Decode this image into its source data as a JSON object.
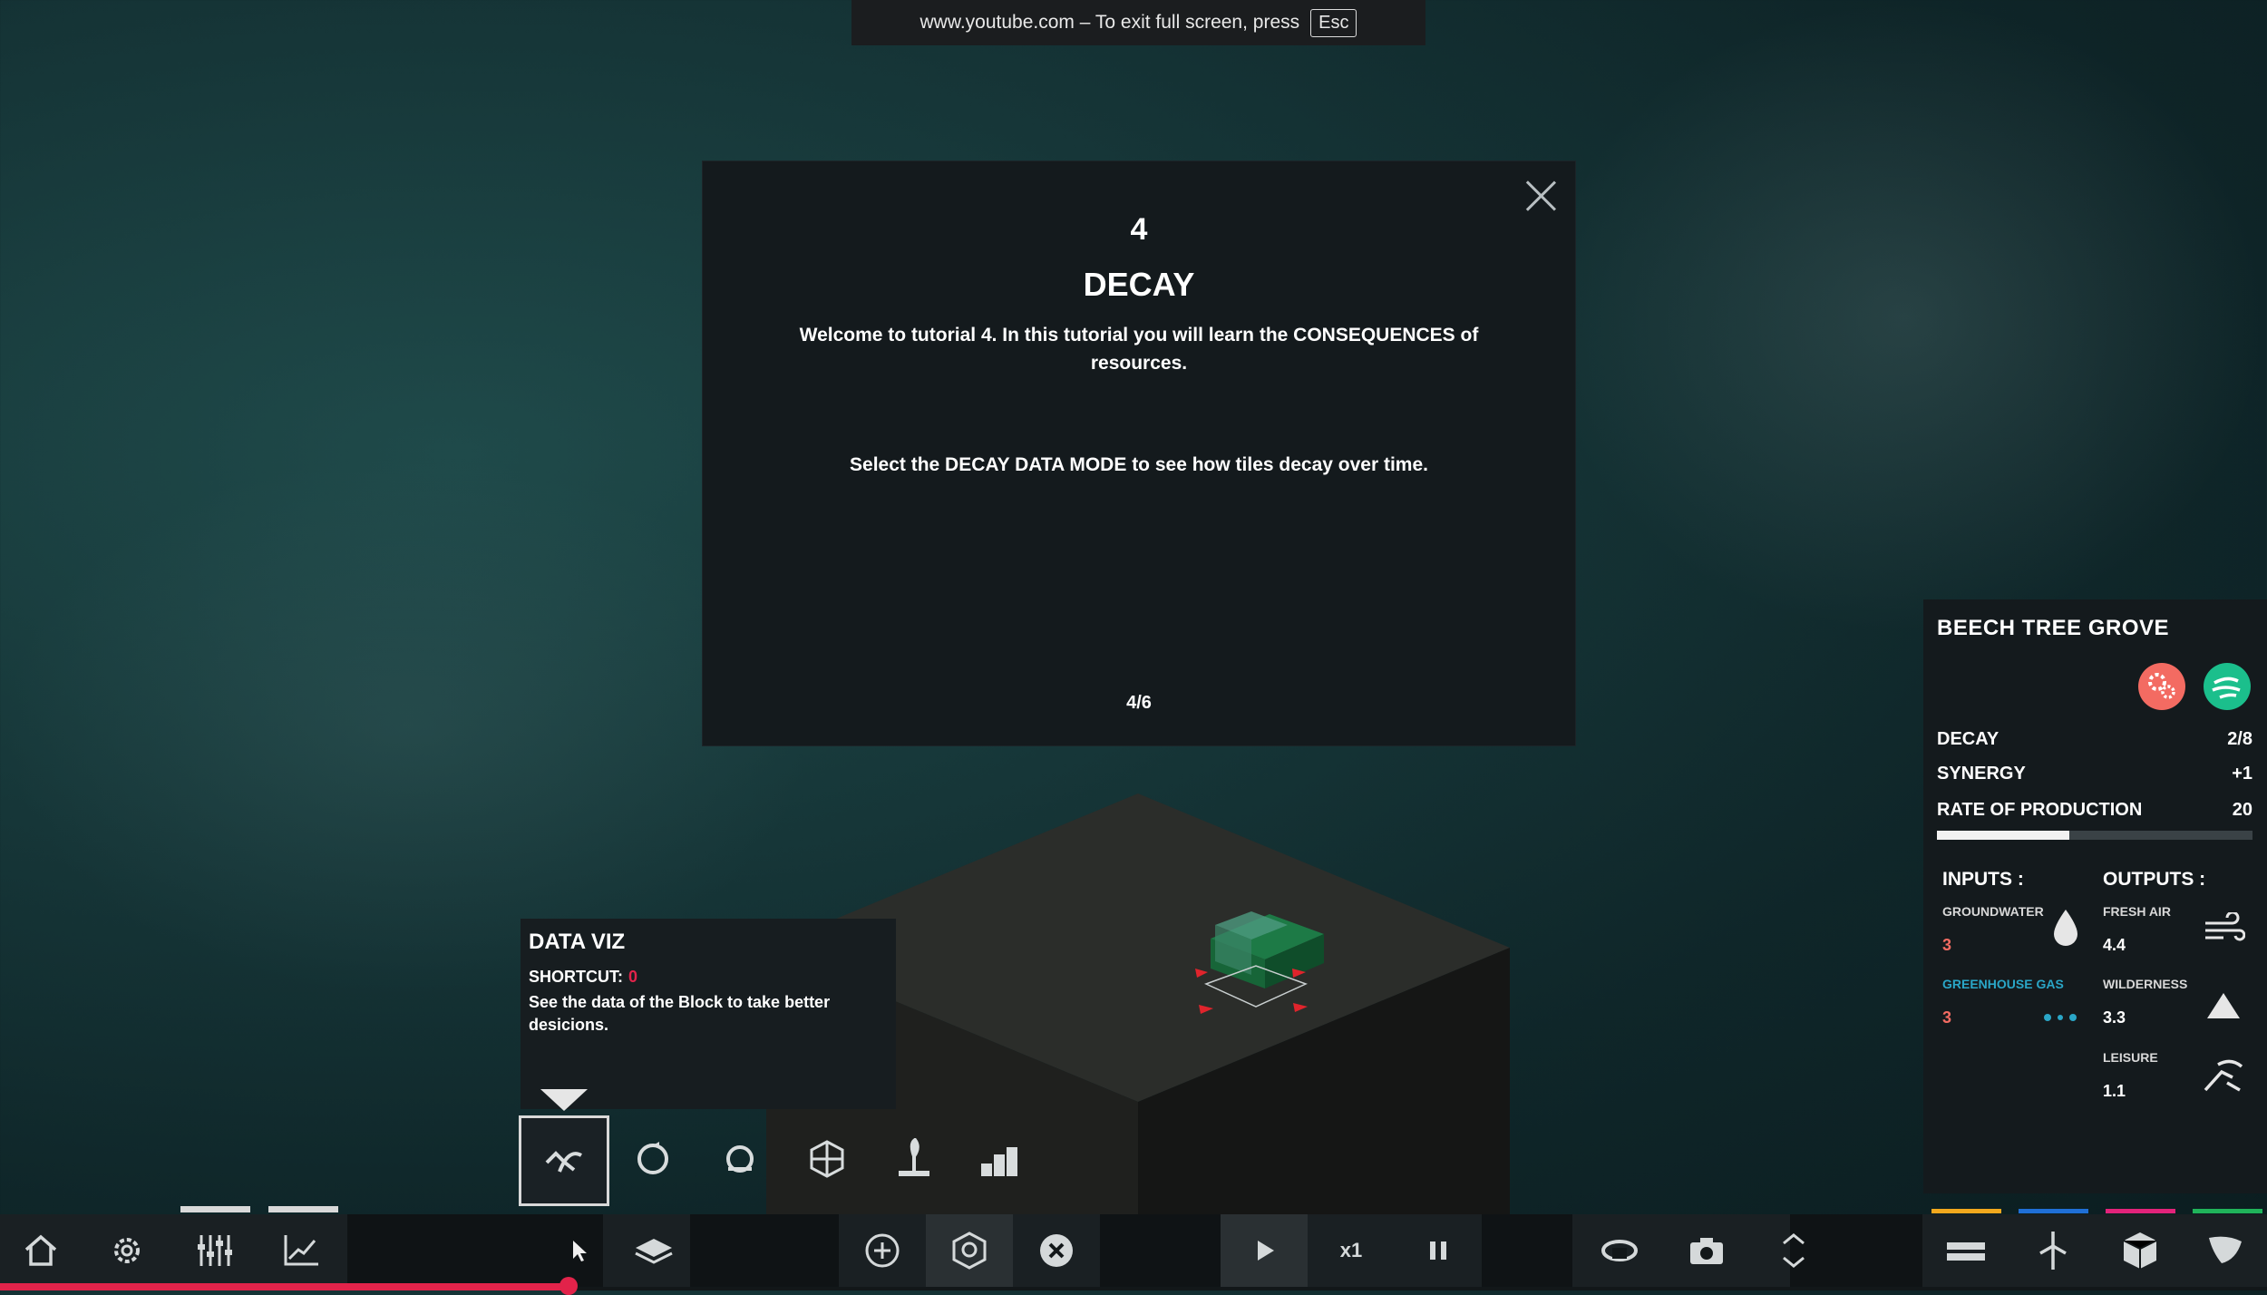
{
  "fullscreen_notice": {
    "text": "www.youtube.com – To exit full screen, press",
    "key": "Esc"
  },
  "tutorial": {
    "number": "4",
    "title": "DECAY",
    "text1": "Welcome to tutorial 4. In this tutorial you will learn the CONSEQUENCES of resources.",
    "text2": "Select the DECAY DATA MODE  to see how tiles decay over time.",
    "page": "4/6"
  },
  "info_panel": {
    "title": "BEECH TREE GROVE",
    "rows": [
      {
        "label": "DECAY",
        "value": "2/8"
      },
      {
        "label": "SYNERGY",
        "value": "+1"
      },
      {
        "label": "RATE OF PRODUCTION",
        "value": "20"
      }
    ],
    "production_fraction": 0.42,
    "inputs_label": "INPUTS :",
    "outputs_label": "OUTPUTS :",
    "inputs": [
      {
        "label": "GROUNDWATER",
        "value": "3",
        "icon": "water-drop-icon"
      },
      {
        "label": "GREENHOUSE GAS",
        "value": "3",
        "icon": "gas-dots-icon"
      }
    ],
    "outputs": [
      {
        "label": "FRESH AIR",
        "value": "4.4",
        "icon": "wind-icon"
      },
      {
        "label": "WILDERNESS",
        "value": "3.3",
        "icon": "mountain-icon"
      },
      {
        "label": "LEISURE",
        "value": "1.1",
        "icon": "leisure-icon"
      }
    ],
    "colors": {
      "red": "#f36b62",
      "green": "#1bbf8c",
      "cyan": "#2aa6c7"
    }
  },
  "tooltip": {
    "title": "DATA VIZ",
    "shortcut_label": "SHORTCUT:",
    "shortcut_key": "0",
    "description": "See the data of the Block to take better desicions."
  },
  "bottom_bar": {
    "speed": "x1"
  },
  "accent_colors": {
    "progress": "#e2234a",
    "strip": [
      "#f2a81d",
      "#1f6fd6",
      "#e2237a",
      "#20b35a"
    ]
  }
}
